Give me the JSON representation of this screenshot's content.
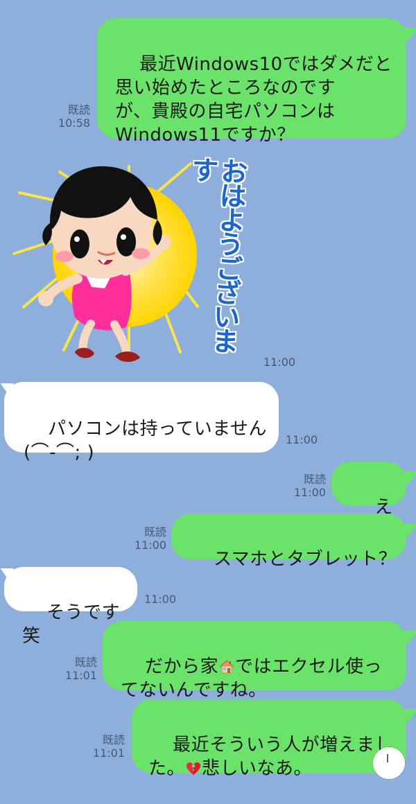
{
  "colors": {
    "background": "#8eaedb",
    "outgoing_bubble": "#6be36b",
    "incoming_bubble": "#ffffff",
    "meta_text": "#41597b"
  },
  "messages": [
    {
      "id": "m1",
      "direction": "outgoing",
      "text": "最近Windows10ではダメだと\n思い始めたところなのです\nが、貴殿の自宅パソコンは\nWindows11ですか？",
      "read": "既読",
      "time": "10:58"
    },
    {
      "id": "m2",
      "direction": "incoming",
      "type": "sticker",
      "sticker_text": "おはようございます",
      "time": "11:00"
    },
    {
      "id": "m3",
      "direction": "incoming",
      "text": "パソコンは持っていません\n(⌒-⌒; )",
      "time": "11:00"
    },
    {
      "id": "m4",
      "direction": "outgoing",
      "text": "えっ",
      "read": "既読",
      "time": "11:00"
    },
    {
      "id": "m5",
      "direction": "outgoing",
      "text": "スマホとタブレット？",
      "read": "既読",
      "time": "11:00"
    },
    {
      "id": "m6",
      "direction": "incoming",
      "text": "そうです笑",
      "time": "11:00"
    },
    {
      "id": "m7",
      "direction": "outgoing",
      "text_parts": [
        "だから家",
        "house-emoji",
        "ではエクセル使っ\nてないんですね。"
      ],
      "read": "既読",
      "time": "11:01"
    },
    {
      "id": "m8",
      "direction": "outgoing",
      "text_parts": [
        "最近そういう人が増えまし\nた。",
        "broken-heart-emoji",
        "悲しいなあ。"
      ],
      "read": "既読",
      "time": "11:01"
    }
  ]
}
